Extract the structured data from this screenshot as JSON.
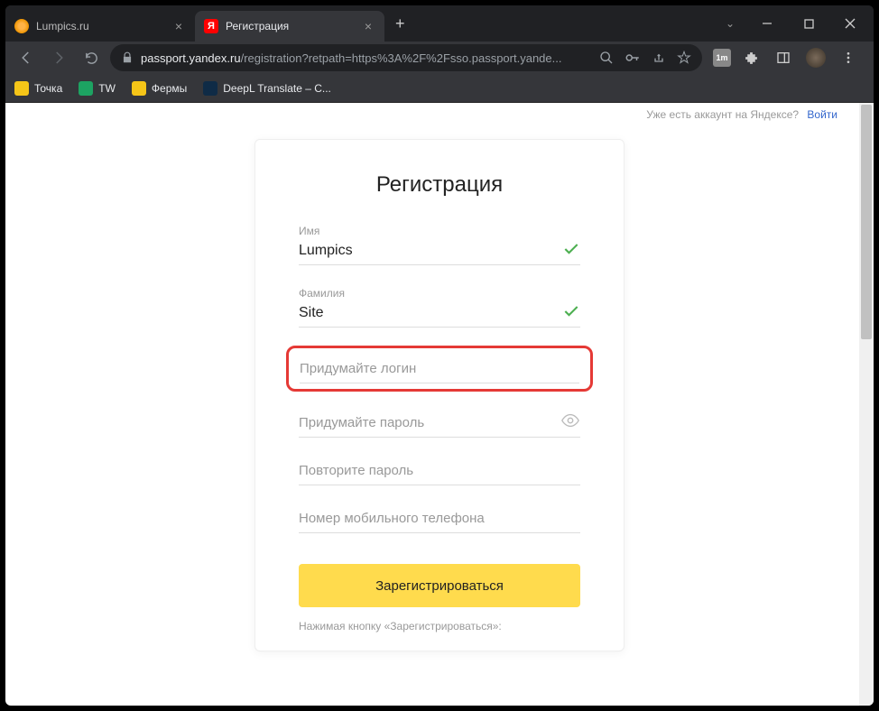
{
  "browser": {
    "tabs": [
      {
        "title": "Lumpics.ru",
        "active": false
      },
      {
        "title": "Регистрация",
        "active": true
      }
    ],
    "url_domain": "passport.yandex.ru",
    "url_path": "/registration?retpath=https%3A%2F%2Fsso.passport.yande...",
    "bookmarks": [
      {
        "label": "Точка",
        "color": "#f5c518"
      },
      {
        "label": "TW",
        "color": "#1da362"
      },
      {
        "label": "Фермы",
        "color": "#f5c518"
      },
      {
        "label": "DeepL Translate – C...",
        "color": "#0f2b46"
      }
    ]
  },
  "header": {
    "already_text": "Уже есть аккаунт на Яндексе?",
    "login_link": "Войти"
  },
  "form": {
    "title": "Регистрация",
    "name_label": "Имя",
    "name_value": "Lumpics",
    "surname_label": "Фамилия",
    "surname_value": "Site",
    "login_placeholder": "Придумайте логин",
    "password_placeholder": "Придумайте пароль",
    "repeat_placeholder": "Повторите пароль",
    "phone_placeholder": "Номер мобильного телефона",
    "submit_label": "Зарегистрироваться",
    "legal_text": "Нажимая кнопку «Зарегистрироваться»:"
  }
}
